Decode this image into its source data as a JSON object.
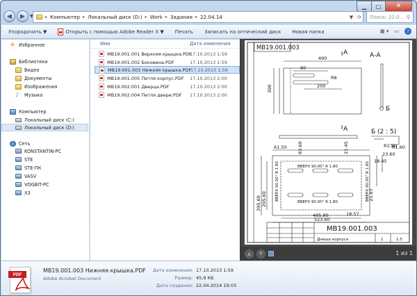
{
  "address": {
    "segments": [
      "Компьютер",
      "Локальный диск (D:)",
      "Work",
      "Задания",
      "22.04.14"
    ],
    "search_placeholder": "Поиск: 22.0..."
  },
  "toolbar": {
    "organize": "Упорядочить ▼",
    "open_with": "Открыть с помощью Adobe Reader X ▼",
    "print": "Печать",
    "burn": "Записать на оптический диск",
    "new_folder": "Новая папка"
  },
  "navigation": {
    "favorites": "Избранное",
    "libraries": "Библиотеки",
    "lib_items": [
      "Видео",
      "Документы",
      "Изображения",
      "Музыка"
    ],
    "computer": "Компьютер",
    "drives": [
      "Локальный диск (C:)",
      "Локальный диск (D:)"
    ],
    "network": "Сеть",
    "hosts": [
      "KONSTANTIN-PC",
      "STE",
      "STE-ПК",
      "VASV",
      "VOGBIT-PC",
      "X3"
    ]
  },
  "file_list": {
    "col_name": "Имя",
    "col_date": "Дата изменения",
    "files": [
      {
        "name": "МВ19.001.001 Верхняя крышка.PDF",
        "date": "17.10.2013 1:59"
      },
      {
        "name": "МВ19.001.002 Боковина.PDF",
        "date": "17.10.2013 1:59"
      },
      {
        "name": "МВ19.001.003 Нижняя крышка.PDF",
        "date": "17.10.2013 1:59"
      },
      {
        "name": "МВ19.001.005 Петля корпус.PDF",
        "date": "17.10.2013 2:00"
      },
      {
        "name": "МВ19.002.001 Дверца.PDF",
        "date": "17.10.2013 2:00"
      },
      {
        "name": "МВ19.002.004 Петля двери.PDF",
        "date": "17.10.2013 2:00"
      }
    ],
    "selected_index": 2
  },
  "preview": {
    "doc_code_top": "МВ19.001.003",
    "doc_code": "МВ19.001.003",
    "section_a": "А",
    "section_aa": "А-А",
    "section_b": "Б",
    "detail_b": "Б (2 : 5)",
    "part_name": "Днище корпуса",
    "scale": "1:5",
    "sheet_note": "1",
    "dims": [
      "490",
      "300",
      "80",
      "R8",
      "200",
      "61.50",
      "83.60",
      "21.45",
      "18.45",
      "R1.60",
      "23.60",
      "395.60",
      "295.60",
      "21.87",
      "18.57",
      "485.80",
      "523.60",
      "R1.80"
    ],
    "labels": [
      "ВВЕРХ  90.00°  R 1.80",
      "ВВЕРХ  90.00°  R 1.80",
      "ВВЕРХ  90.00°  R 1.80",
      "ВВЕРХ  90.00°  R 1.80"
    ],
    "page_indicator": "1 из 1"
  },
  "details": {
    "file_name": "МВ19.001.003 Нижняя крышка.PDF",
    "file_type": "Adobe Acrobat Document",
    "modified_label": "Дата изменения:",
    "modified_value": "17.10.2013 1:59",
    "size_label": "Размер:",
    "size_value": "45,9 КБ",
    "created_label": "Дата создания:",
    "created_value": "22.04.2014 19:03",
    "icon_label": "PDF"
  }
}
